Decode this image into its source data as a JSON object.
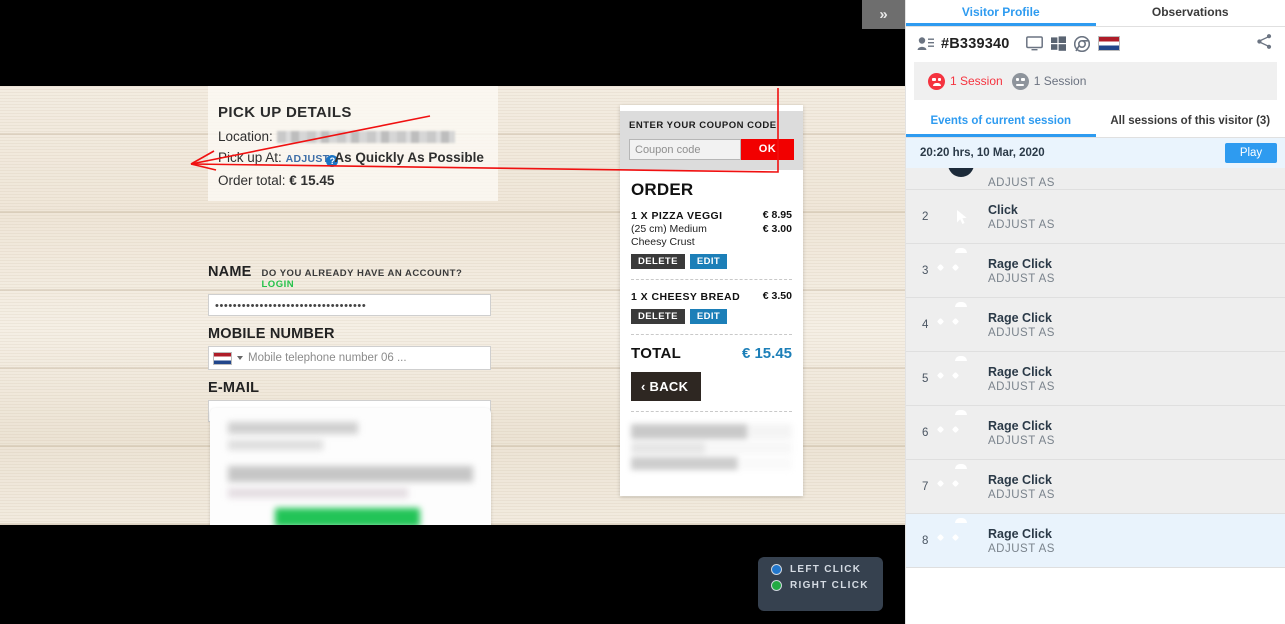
{
  "replay": {
    "collapse_label": "»",
    "pickup": {
      "title": "PICK UP DETAILS",
      "location_label": "Location:",
      "location_value": "",
      "pickup_label": "Pick up At:",
      "adjust_link": "ADJUST",
      "adjust_badge": "?",
      "pickup_value": "As Quickly As Possible",
      "order_total_label": "Order total:",
      "order_total_value": "€ 15.45"
    },
    "form": {
      "name_label": "NAME",
      "account_question": "DO YOU ALREADY HAVE AN ACCOUNT?",
      "login_link": "LOGIN",
      "name_value": "••••••••••••••••••••••••••••••••••",
      "mobile_label": "MOBILE NUMBER",
      "mobile_placeholder": "Mobile telephone number 06 ...",
      "mobile_country": "NL",
      "email_label": "E-MAIL",
      "email_value": "••••••••••••••••••••••••••••••••••••••••"
    },
    "receipt": {
      "coupon_title": "ENTER YOUR COUPON CODE",
      "coupon_placeholder": "Coupon code",
      "coupon_ok": "OK",
      "order_heading": "ORDER",
      "items": [
        {
          "name": "1 X PIZZA VEGGI",
          "price": "€ 8.95",
          "option": "(25 cm) Medium Cheesy Crust",
          "option_price": "€ 3.00",
          "delete_label": "DELETE",
          "edit_label": "EDIT"
        },
        {
          "name": "1 X CHEESY BREAD",
          "price": "€ 3.50",
          "option": "",
          "option_price": "",
          "delete_label": "DELETE",
          "edit_label": "EDIT"
        }
      ],
      "total_label": "TOTAL",
      "total_value": "€ 15.45",
      "back_label": "‹ BACK"
    },
    "legend": {
      "left_click": "LEFT CLICK",
      "right_click": "RIGHT CLICK",
      "left_color": "#2277cc",
      "right_color": "#22aa44"
    }
  },
  "panel": {
    "top_tabs": [
      {
        "label": "Visitor Profile",
        "active": true
      },
      {
        "label": "Observations",
        "active": false
      }
    ],
    "visitor": {
      "id": "#B339340",
      "icons": [
        "visitor-card-icon",
        "desktop-icon",
        "windows-icon",
        "chrome-icon",
        "flag-nl-icon"
      ],
      "share_icon": "share-icon"
    },
    "sessions": [
      {
        "type": "frustrated",
        "label": "1 Session",
        "color": "#f5333f"
      },
      {
        "type": "neutral",
        "label": "1 Session",
        "color": "#8e949c"
      }
    ],
    "sub_tabs": [
      {
        "label": "Events of current session",
        "active": true
      },
      {
        "label": "All sessions of this visitor (3)",
        "active": false
      }
    ],
    "timestamp": "20:20 hrs, 10 Mar, 2020",
    "play_label": "Play",
    "events": [
      {
        "num": "",
        "icon": "click-icon",
        "title": "",
        "sub": "ADJUST AS",
        "clipped": true,
        "highlight": false
      },
      {
        "num": "2",
        "icon": "click-icon",
        "title": "Click",
        "sub": "ADJUST AS",
        "clipped": false,
        "highlight": false
      },
      {
        "num": "3",
        "icon": "rage-click-icon",
        "title": "Rage Click",
        "sub": "ADJUST AS",
        "clipped": false,
        "highlight": false
      },
      {
        "num": "4",
        "icon": "rage-click-icon",
        "title": "Rage Click",
        "sub": "ADJUST AS",
        "clipped": false,
        "highlight": false
      },
      {
        "num": "5",
        "icon": "rage-click-icon",
        "title": "Rage Click",
        "sub": "ADJUST AS",
        "clipped": false,
        "highlight": false
      },
      {
        "num": "6",
        "icon": "rage-click-icon",
        "title": "Rage Click",
        "sub": "ADJUST AS",
        "clipped": false,
        "highlight": false
      },
      {
        "num": "7",
        "icon": "rage-click-icon",
        "title": "Rage Click",
        "sub": "ADJUST AS",
        "clipped": false,
        "highlight": false
      },
      {
        "num": "8",
        "icon": "rage-click-icon",
        "title": "Rage Click",
        "sub": "ADJUST AS",
        "clipped": false,
        "highlight": true
      }
    ]
  }
}
